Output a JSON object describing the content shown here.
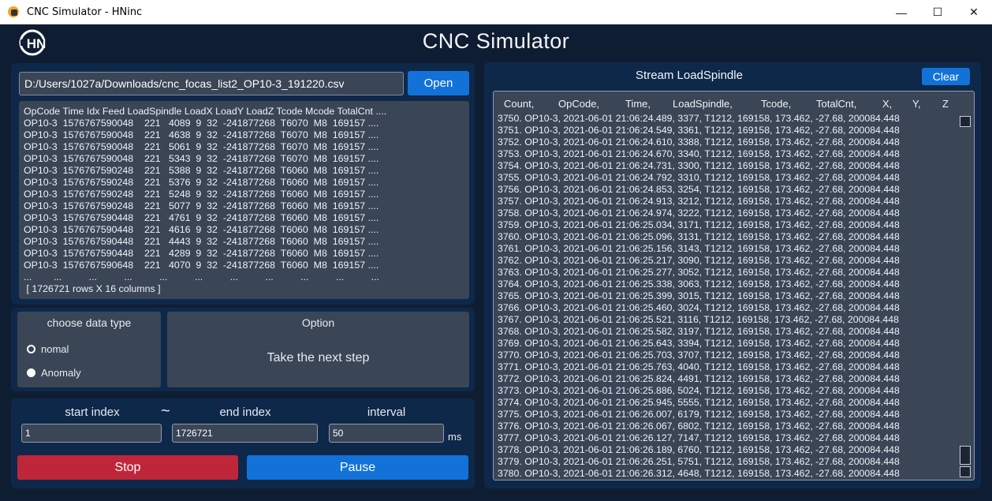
{
  "window": {
    "title": "CNC Simulator - HNinc",
    "minimize_glyph": "—",
    "maximize_glyph": "☐",
    "close_glyph": "✕"
  },
  "header": {
    "logo_text": "HN",
    "app_title": "CNC Simulator"
  },
  "file": {
    "path": "D:/Users/1027a/Downloads/cnc_focas_list2_OP10-3_191220.csv",
    "open_label": "Open"
  },
  "preview": {
    "header_line": "OpCode Time Idx Feed LoadSpindle LoadX LoadY LoadZ Tcode Mcode TotalCnt ....",
    "rows": [
      "OP10-3  1576767590048    221   4089  9  32  -241877268  T6070  M8  169157 ....",
      "OP10-3  1576767590048    221   4638  9  32  -241877268  T6070  M8  169157 ....",
      "OP10-3  1576767590048    221   5061  9  32  -241877268  T6070  M8  169157 ....",
      "OP10-3  1576767590048    221   5343  9  32  -241877268  T6070  M8  169157 ....",
      "OP10-3  1576767590248    221   5388  9  32  -241877268  T6060  M8  169157 ....",
      "OP10-3  1576767590248    221   5376  9  32  -241877268  T6060  M8  169157 ....",
      "OP10-3  1576767590248    221   5248  9  32  -241877268  T6060  M8  169157 ....",
      "OP10-3  1576767590248    221   5077  9  32  -241877268  T6060  M8  169157 ....",
      "OP10-3  1576767590448    221   4761  9  32  -241877268  T6060  M8  169157 ....",
      "OP10-3  1576767590448    221   4616  9  32  -241877268  T6060  M8  169157 ....",
      "OP10-3  1576767590448    221   4443  9  32  -241877268  T6060  M8  169157 ....",
      "OP10-3  1576767590448    221   4289  9  32  -241877268  T6060  M8  169157 ....",
      "OP10-3  1576767590648    221   4070  9  32  -241877268  T6060  M8  169157 ...."
    ],
    "ellipsis_line": "...        ...          ...          ...          ...          ...          ...          ...          ...          ...          ...",
    "summary": " [ 1726721 rows X 16 columns ]"
  },
  "data_type": {
    "title": "choose data type",
    "options": [
      {
        "label": "nomal",
        "checked": true
      },
      {
        "label": "Anomaly",
        "checked": false
      }
    ]
  },
  "option": {
    "title": "Option",
    "text": "Take the next step"
  },
  "controls": {
    "start_label": "start index",
    "tilde": "~",
    "end_label": "end index",
    "interval_label": "interval",
    "start_value": "1",
    "end_value": "1726721",
    "interval_value": "50",
    "unit": "ms",
    "stop_label": "Stop",
    "pause_label": "Pause"
  },
  "stream": {
    "title": "Stream LoadSpindle",
    "clear_label": "Clear",
    "columns": [
      "Count,",
      "OpCode,",
      "Time,",
      "LoadSpindle,",
      "Tcode,",
      "TotalCnt,",
      "X,",
      "Y,",
      "Z"
    ],
    "lines": [
      "3750. OP10-3, 2021-06-01 21:06:24.489, 3377, T1212, 169158, 173.462, -27.68, 200084.448",
      "3751. OP10-3, 2021-06-01 21:06:24.549, 3361, T1212, 169158, 173.462, -27.68, 200084.448",
      "3752. OP10-3, 2021-06-01 21:06:24.610, 3388, T1212, 169158, 173.462, -27.68, 200084.448",
      "3753. OP10-3, 2021-06-01 21:06:24.670, 3340, T1212, 169158, 173.462, -27.68, 200084.448",
      "3754. OP10-3, 2021-06-01 21:06:24.731, 3300, T1212, 169158, 173.462, -27.68, 200084.448",
      "3755. OP10-3, 2021-06-01 21:06:24.792, 3310, T1212, 169158, 173.462, -27.68, 200084.448",
      "3756. OP10-3, 2021-06-01 21:06:24.853, 3254, T1212, 169158, 173.462, -27.68, 200084.448",
      "3757. OP10-3, 2021-06-01 21:06:24.913, 3212, T1212, 169158, 173.462, -27.68, 200084.448",
      "3758. OP10-3, 2021-06-01 21:06:24.974, 3222, T1212, 169158, 173.462, -27.68, 200084.448",
      "3759. OP10-3, 2021-06-01 21:06:25.034, 3171, T1212, 169158, 173.462, -27.68, 200084.448",
      "3760. OP10-3, 2021-06-01 21:06:25.096, 3131, T1212, 169158, 173.462, -27.68, 200084.448",
      "3761. OP10-3, 2021-06-01 21:06:25.156, 3143, T1212, 169158, 173.462, -27.68, 200084.448",
      "3762. OP10-3, 2021-06-01 21:06:25.217, 3090, T1212, 169158, 173.462, -27.68, 200084.448",
      "3763. OP10-3, 2021-06-01 21:06:25.277, 3052, T1212, 169158, 173.462, -27.68, 200084.448",
      "3764. OP10-3, 2021-06-01 21:06:25.338, 3063, T1212, 169158, 173.462, -27.68, 200084.448",
      "3765. OP10-3, 2021-06-01 21:06:25.399, 3015, T1212, 169158, 173.462, -27.68, 200084.448",
      "3766. OP10-3, 2021-06-01 21:06:25.460, 3024, T1212, 169158, 173.462, -27.68, 200084.448",
      "3767. OP10-3, 2021-06-01 21:06:25.521, 3116, T1212, 169158, 173.462, -27.68, 200084.448",
      "3768. OP10-3, 2021-06-01 21:06:25.582, 3197, T1212, 169158, 173.462, -27.68, 200084.448",
      "3769. OP10-3, 2021-06-01 21:06:25.643, 3394, T1212, 169158, 173.462, -27.68, 200084.448",
      "3770. OP10-3, 2021-06-01 21:06:25.703, 3707, T1212, 169158, 173.462, -27.68, 200084.448",
      "3771. OP10-3, 2021-06-01 21:06:25.763, 4040, T1212, 169158, 173.462, -27.68, 200084.448",
      "3772. OP10-3, 2021-06-01 21:06:25.824, 4491, T1212, 169158, 173.462, -27.68, 200084.448",
      "3773. OP10-3, 2021-06-01 21:06:25.886, 5024, T1212, 169158, 173.462, -27.68, 200084.448",
      "3774. OP10-3, 2021-06-01 21:06:25.945, 5555, T1212, 169158, 173.462, -27.68, 200084.448",
      "3775. OP10-3, 2021-06-01 21:06:26.007, 6179, T1212, 169158, 173.462, -27.68, 200084.448",
      "3776. OP10-3, 2021-06-01 21:06:26.067, 6802, T1212, 169158, 173.462, -27.68, 200084.448",
      "3777. OP10-3, 2021-06-01 21:06:26.127, 7147, T1212, 169158, 173.462, -27.68, 200084.448",
      "3778. OP10-3, 2021-06-01 21:06:26.189, 6760, T1212, 169158, 173.462, -27.68, 200084.448",
      "3779. OP10-3, 2021-06-01 21:06:26.251, 5751, T1212, 169158, 173.462, -27.68, 200084.448",
      "3780. OP10-3, 2021-06-01 21:06:26.312, 4648, T1212, 169158, 173.462, -27.68, 200084.448"
    ]
  },
  "colors": {
    "background": "#0f1d33",
    "panel": "#0e284a",
    "field": "#3a4556",
    "primary_button": "#1272d8",
    "stop_button": "#c0263a"
  },
  "icons": {
    "app": "cnc-app-icon",
    "logo": "hn-logo-icon"
  }
}
